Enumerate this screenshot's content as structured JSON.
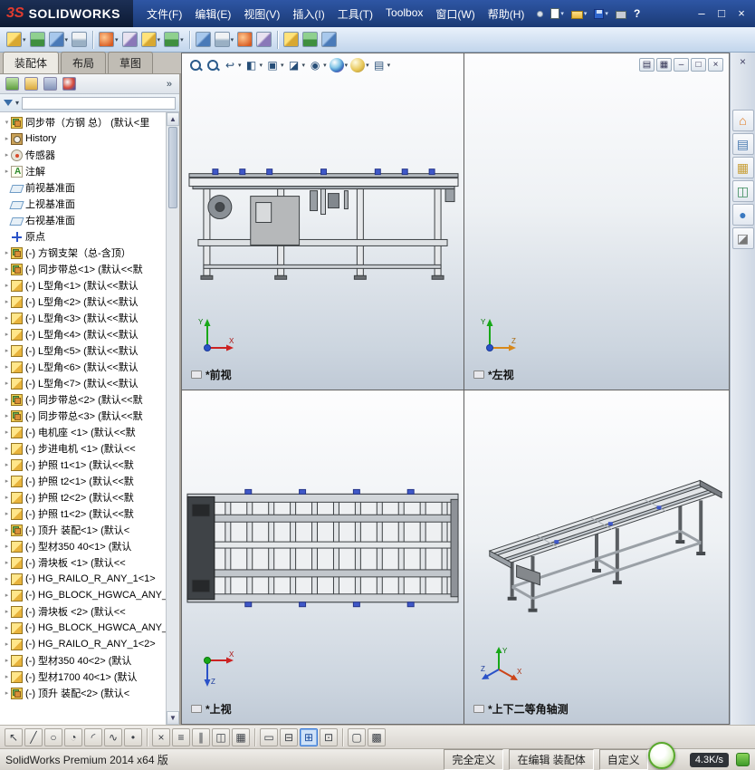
{
  "titlebar": {
    "brand_mark": "3S",
    "brand": "SOLIDWORKS",
    "menus": [
      "文件(F)",
      "编辑(E)",
      "视图(V)",
      "插入(I)",
      "工具(T)",
      "Toolbox",
      "窗口(W)",
      "帮助(H)"
    ],
    "quick_buttons": [
      "pin",
      "new-document",
      "open-document",
      "save-document",
      "print",
      "help"
    ],
    "window_buttons": [
      "minimize",
      "restore",
      "close"
    ]
  },
  "assembly_toolbar": {
    "groups": [
      [
        {
          "n": "insert-components",
          "dd": true
        },
        {
          "n": "mate",
          "dd": false
        },
        {
          "n": "linear-component-pattern",
          "dd": true
        },
        {
          "n": "smart-fasteners",
          "dd": false
        }
      ],
      [
        {
          "n": "move-component",
          "dd": true
        },
        {
          "n": "show-hidden-components",
          "dd": false
        },
        {
          "n": "assembly-features",
          "dd": true
        },
        {
          "n": "reference-geometry",
          "dd": true
        }
      ],
      [
        {
          "n": "new-motion-study",
          "dd": false
        },
        {
          "n": "bill-of-materials",
          "dd": true
        },
        {
          "n": "exploded-view",
          "dd": false
        },
        {
          "n": "explode-line-sketch",
          "dd": false
        }
      ],
      [
        {
          "n": "interference-detection",
          "dd": false
        },
        {
          "n": "measure",
          "dd": false
        },
        {
          "n": "mass-properties",
          "dd": false
        }
      ]
    ]
  },
  "command_tabs": [
    {
      "label": "装配体",
      "active": true
    },
    {
      "label": "布局",
      "active": false
    },
    {
      "label": "草图",
      "active": false
    }
  ],
  "viewport_toolbar": [
    {
      "n": "zoom-to-fit",
      "dd": false
    },
    {
      "n": "zoom-to-area",
      "dd": false
    },
    {
      "n": "previous-view",
      "dd": true
    },
    {
      "n": "section-view",
      "dd": true
    },
    {
      "n": "view-orientation",
      "dd": true
    },
    {
      "n": "display-style",
      "dd": true
    },
    {
      "n": "hide-show-items",
      "dd": true
    },
    {
      "n": "edit-appearance",
      "dd": true
    },
    {
      "n": "apply-scene",
      "dd": true
    },
    {
      "n": "view-settings",
      "dd": true
    }
  ],
  "document_window_buttons": [
    "tile-top",
    "tile-side",
    "minimize",
    "restore",
    "close"
  ],
  "manager_panel": {
    "tabs": [
      "feature-manager",
      "property-manager",
      "configuration-manager",
      "dimxpert-manager"
    ],
    "overflow": "»"
  },
  "feature_tree": {
    "root_label": "同步带（方钢 总） (默认<里",
    "items": [
      {
        "icon": "history",
        "label": "History"
      },
      {
        "icon": "sensor",
        "label": "传感器"
      },
      {
        "icon": "annotations",
        "label": "注解"
      },
      {
        "icon": "plane",
        "label": "前视基准面"
      },
      {
        "icon": "plane",
        "label": "上视基准面"
      },
      {
        "icon": "plane",
        "label": "右视基准面"
      },
      {
        "icon": "origin",
        "label": "原点"
      },
      {
        "icon": "asm",
        "label": "(-) 方钢支架（总-含顶）"
      },
      {
        "icon": "asm",
        "label": "(-) 同步带总<1> (默认<<默"
      },
      {
        "icon": "part",
        "label": "(-) L型角<1> (默认<<默认"
      },
      {
        "icon": "part",
        "label": "(-) L型角<2> (默认<<默认"
      },
      {
        "icon": "part",
        "label": "(-) L型角<3> (默认<<默认"
      },
      {
        "icon": "part",
        "label": "(-) L型角<4> (默认<<默认"
      },
      {
        "icon": "part",
        "label": "(-) L型角<5> (默认<<默认"
      },
      {
        "icon": "part",
        "label": "(-) L型角<6> (默认<<默认"
      },
      {
        "icon": "part",
        "label": "(-) L型角<7> (默认<<默认"
      },
      {
        "icon": "asm",
        "label": "(-) 同步带总<2> (默认<<默"
      },
      {
        "icon": "asm",
        "label": "(-) 同步带总<3> (默认<<默"
      },
      {
        "icon": "part",
        "label": "(-) 电机座 <1> (默认<<默"
      },
      {
        "icon": "part",
        "label": "(-) 步进电机 <1> (默认<<"
      },
      {
        "icon": "part",
        "label": "(-) 护照 t1<1> (默认<<默"
      },
      {
        "icon": "part",
        "label": "(-) 护照 t2<1> (默认<<默"
      },
      {
        "icon": "part",
        "label": "(-) 护照 t2<2> (默认<<默"
      },
      {
        "icon": "part",
        "label": "(-) 护照 t1<2> (默认<<默"
      },
      {
        "icon": "asm",
        "label": "(-) 顶升 装配<1> (默认<"
      },
      {
        "icon": "part",
        "label": "(-) 型材350 40<1> (默认"
      },
      {
        "icon": "part",
        "label": "(-) 滑块板 <1> (默认<<"
      },
      {
        "icon": "part",
        "label": "(-) HG_RAILO_R_ANY_1<1>"
      },
      {
        "icon": "part",
        "label": "(-) HG_BLOCK_HGWCA_ANY_"
      },
      {
        "icon": "part",
        "label": "(-) 滑块板 <2> (默认<<"
      },
      {
        "icon": "part",
        "label": "(-) HG_BLOCK_HGWCA_ANY_"
      },
      {
        "icon": "part",
        "label": "(-) HG_RAILO_R_ANY_1<2>"
      },
      {
        "icon": "part",
        "label": "(-) 型材350 40<2> (默认"
      },
      {
        "icon": "part",
        "label": "(-) 型材1700 40<1> (默认"
      },
      {
        "icon": "asm",
        "label": "(-) 顶升 装配<2> (默认<"
      }
    ]
  },
  "viewports": [
    {
      "id": "front",
      "label": "*前视"
    },
    {
      "id": "left",
      "label": "*左视"
    },
    {
      "id": "top",
      "label": "*上视"
    },
    {
      "id": "isometric",
      "label": "*上下二等角轴测"
    }
  ],
  "task_pane": [
    "solidworks-resources",
    "design-library",
    "file-explorer",
    "view-palette",
    "appearances",
    "custom-properties"
  ],
  "sketch_toolbar": {
    "groups": [
      [
        {
          "n": "select"
        },
        {
          "n": "line"
        },
        {
          "n": "circle"
        },
        {
          "n": "centerpoint-arc"
        },
        {
          "n": "tangent-arc"
        },
        {
          "n": "spline"
        },
        {
          "n": "point"
        }
      ],
      [
        {
          "n": "trim-entities"
        },
        {
          "n": "convert-entities"
        },
        {
          "n": "offset-entities"
        },
        {
          "n": "mirror-entities"
        },
        {
          "n": "linear-sketch-pattern"
        }
      ],
      [
        {
          "n": "single-view"
        },
        {
          "n": "two-view-horizontal"
        },
        {
          "n": "four-view",
          "active": true
        },
        {
          "n": "two-view-vertical"
        }
      ],
      [
        {
          "n": "full-screen"
        },
        {
          "n": "grid"
        }
      ]
    ]
  },
  "status_bar": {
    "app_info": "SolidWorks Premium 2014 x64 版",
    "definition_state": "完全定义",
    "edit_state": "在编辑 装配体",
    "custom_label": "自定义",
    "net_speed": "4.3K/s"
  },
  "colors": {
    "titlebar_dark": "#16294e",
    "accent_blue": "#3f58c8",
    "brand_red": "#e23b2e",
    "viewport_top": "#fdfdfe",
    "viewport_bottom": "#c0cad6"
  }
}
